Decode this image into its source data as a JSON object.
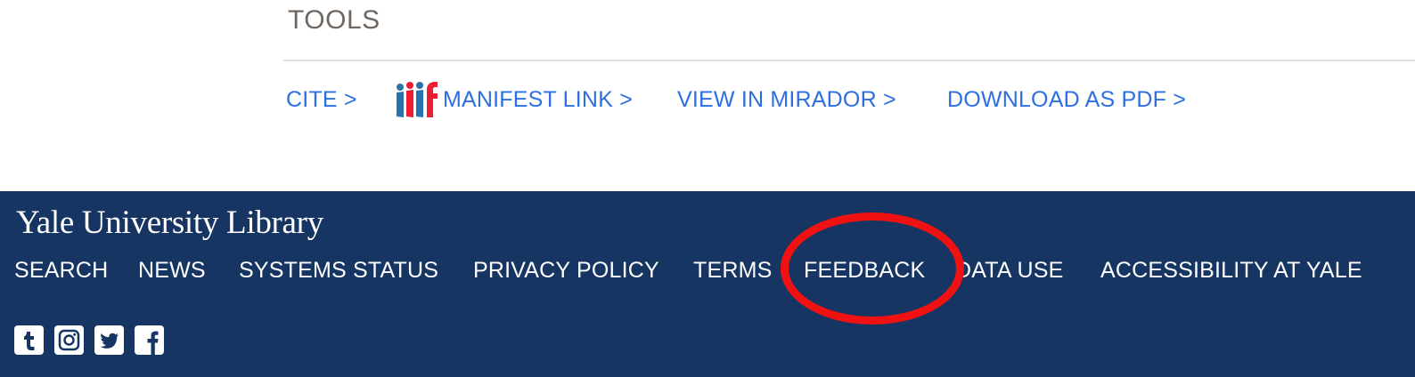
{
  "tools": {
    "title": "TOOLS",
    "links": {
      "cite": "CITE >",
      "manifest": "MANIFEST LINK >",
      "mirador": "VIEW IN MIRADOR >",
      "pdf": "DOWNLOAD AS PDF >"
    },
    "manifest_icon": "iiif-logo-icon",
    "link_color": "#2d6fe0"
  },
  "footer": {
    "logo": "Yale University Library",
    "background_color": "#173563",
    "nav": {
      "search": "SEARCH",
      "news": "NEWS",
      "systems_status": "SYSTEMS STATUS",
      "privacy_policy": "PRIVACY POLICY",
      "terms": "TERMS",
      "feedback": "FEEDBACK",
      "data_use": "DATA USE",
      "accessibility": "ACCESSIBILITY AT YALE"
    },
    "social": [
      "tumblr-icon",
      "instagram-icon",
      "twitter-icon",
      "facebook-icon"
    ]
  },
  "annotation": {
    "shape": "ellipse",
    "color": "#f01212",
    "target": "FEEDBACK"
  }
}
